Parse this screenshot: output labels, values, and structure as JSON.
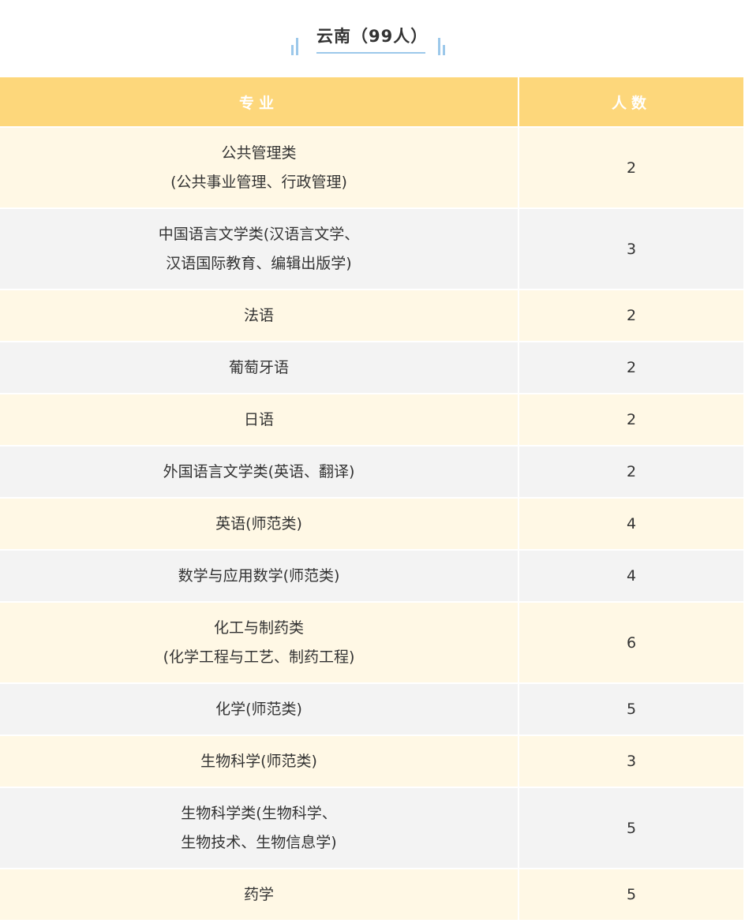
{
  "title": "云南（99人）",
  "table": {
    "headers": {
      "major": "专业",
      "count": "人数"
    },
    "rows": [
      {
        "major_line1": "公共管理类",
        "major_line2": "(公共事业管理、行政管理)",
        "count": "2"
      },
      {
        "major_line1": "中国语言文学类(汉语言文学、",
        "major_line2": "汉语国际教育、编辑出版学)",
        "count": "3"
      },
      {
        "major_line1": "法语",
        "count": "2"
      },
      {
        "major_line1": "葡萄牙语",
        "count": "2"
      },
      {
        "major_line1": "日语",
        "count": "2"
      },
      {
        "major_line1": "外国语言文学类(英语、翻译)",
        "count": "2"
      },
      {
        "major_line1": "英语(师范类)",
        "count": "4"
      },
      {
        "major_line1": "数学与应用数学(师范类)",
        "count": "4"
      },
      {
        "major_line1": "化工与制药类",
        "major_line2": "(化学工程与工艺、制药工程)",
        "count": "6"
      },
      {
        "major_line1": "化学(师范类)",
        "count": "5"
      },
      {
        "major_line1": "生物科学(师范类)",
        "count": "3"
      },
      {
        "major_line1": "生物科学类(生物科学、",
        "major_line2": "生物技术、生物信息学)",
        "count": "5"
      },
      {
        "major_line1": "药学",
        "count": "5"
      }
    ]
  },
  "colors": {
    "header_bg": "#fdd77b",
    "row_odd_bg": "#fff8e5",
    "row_even_bg": "#f3f3f3",
    "accent_blue": "#9cc8ea"
  }
}
